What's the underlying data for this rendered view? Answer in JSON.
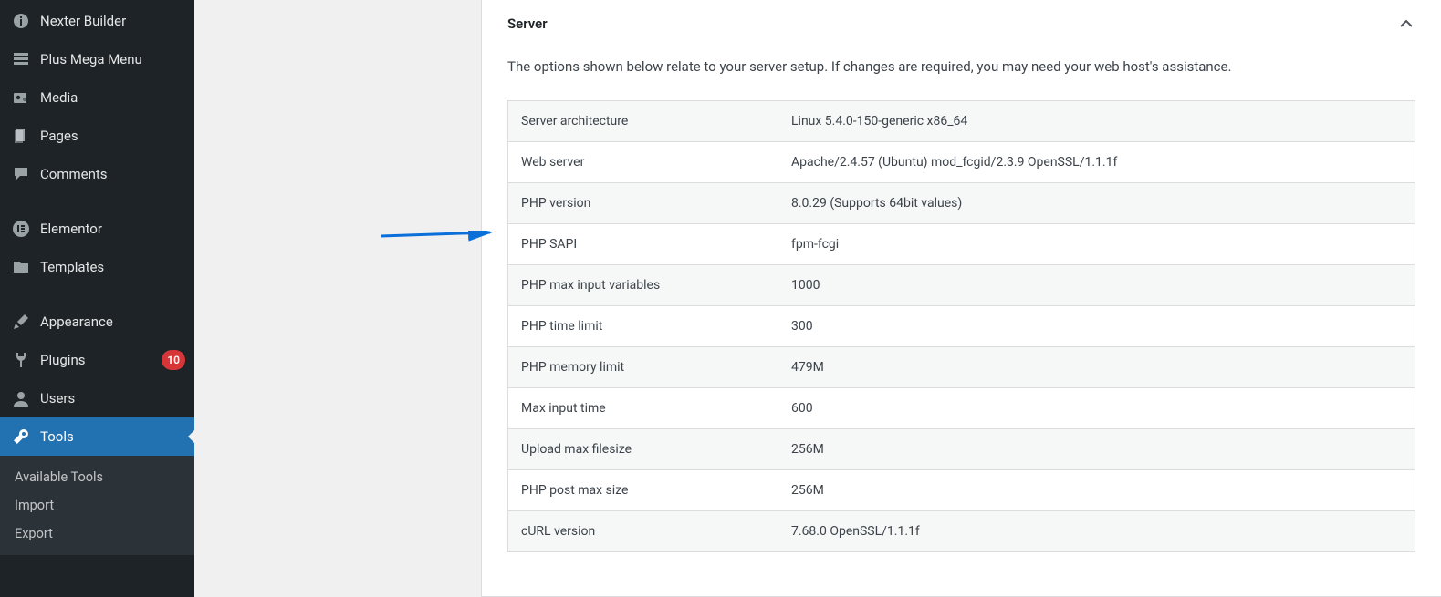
{
  "sidebar": {
    "items": [
      {
        "label": "Nexter Builder",
        "icon": "info-icon"
      },
      {
        "label": "Plus Mega Menu",
        "icon": "grid-icon"
      },
      {
        "label": "Media",
        "icon": "camera-icon"
      },
      {
        "label": "Pages",
        "icon": "page-icon"
      },
      {
        "label": "Comments",
        "icon": "comment-icon"
      }
    ],
    "group2": [
      {
        "label": "Elementor",
        "icon": "elementor-icon"
      },
      {
        "label": "Templates",
        "icon": "folder-icon"
      }
    ],
    "group3": [
      {
        "label": "Appearance",
        "icon": "brush-icon"
      },
      {
        "label": "Plugins",
        "icon": "plug-icon",
        "badge": "10"
      },
      {
        "label": "Users",
        "icon": "user-icon"
      },
      {
        "label": "Tools",
        "icon": "wrench-icon",
        "active": true
      }
    ],
    "submenu": [
      {
        "label": "Available Tools"
      },
      {
        "label": "Import"
      },
      {
        "label": "Export"
      }
    ]
  },
  "panel": {
    "title": "Server",
    "description": "The options shown below relate to your server setup. If changes are required, you may need your web host's assistance."
  },
  "rows": [
    {
      "label": "Server architecture",
      "value": "Linux 5.4.0-150-generic x86_64"
    },
    {
      "label": "Web server",
      "value": "Apache/2.4.57 (Ubuntu) mod_fcgid/2.3.9 OpenSSL/1.1.1f"
    },
    {
      "label": "PHP version",
      "value": "8.0.29 (Supports 64bit values)"
    },
    {
      "label": "PHP SAPI",
      "value": "fpm-fcgi"
    },
    {
      "label": "PHP max input variables",
      "value": "1000"
    },
    {
      "label": "PHP time limit",
      "value": "300"
    },
    {
      "label": "PHP memory limit",
      "value": "479M"
    },
    {
      "label": "Max input time",
      "value": "600"
    },
    {
      "label": "Upload max filesize",
      "value": "256M"
    },
    {
      "label": "PHP post max size",
      "value": "256M"
    },
    {
      "label": "cURL version",
      "value": "7.68.0 OpenSSL/1.1.1f"
    }
  ]
}
